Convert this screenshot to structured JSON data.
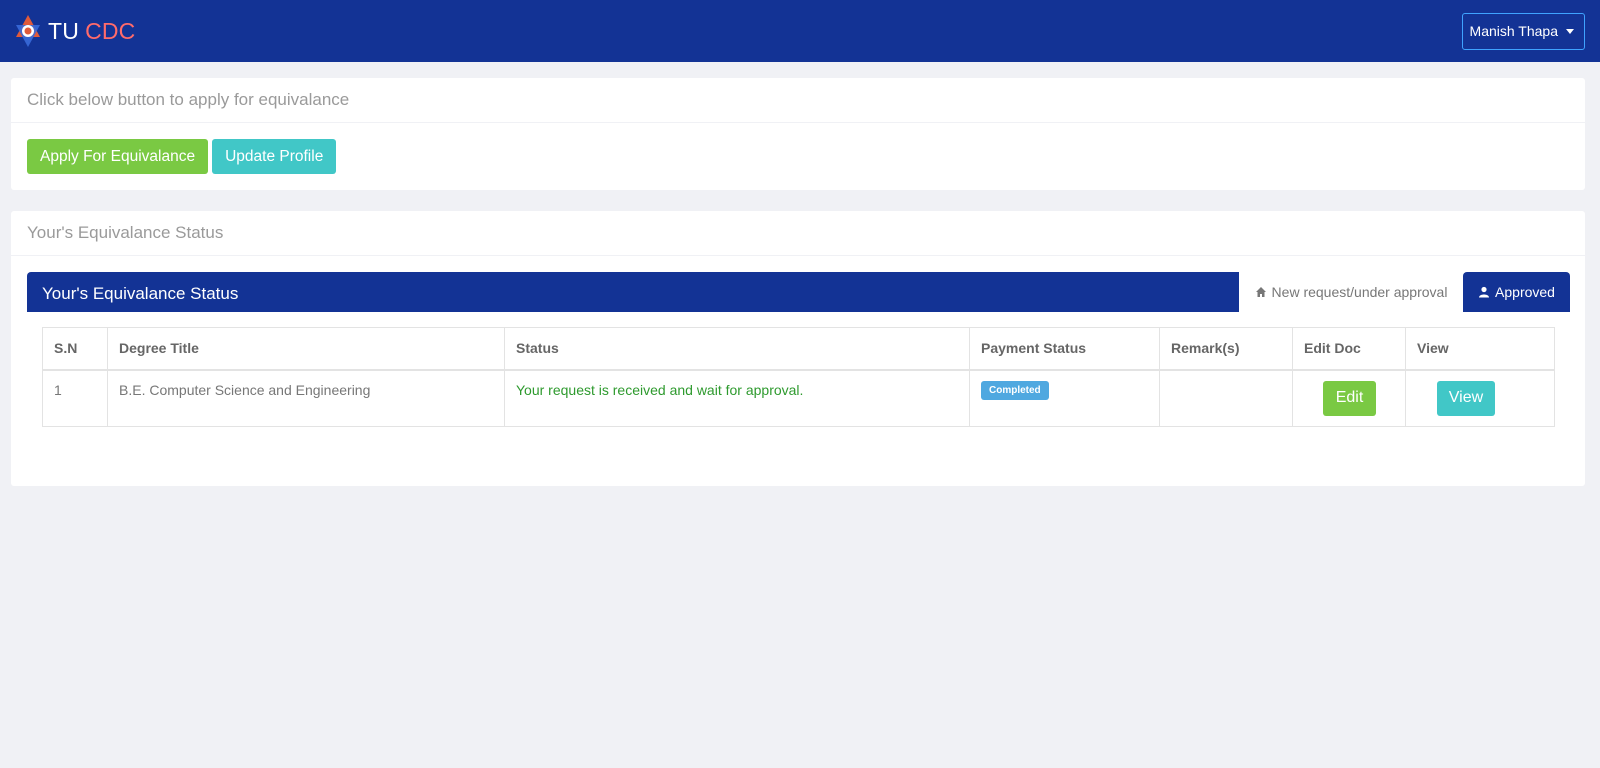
{
  "brand": {
    "tu": "TU",
    "cdc": "CDC",
    "logo_icon": "nepal-star-logo"
  },
  "user": {
    "name": "Manish Thapa"
  },
  "apply_card": {
    "header": "Click below button to apply for equivalance",
    "apply_button": "Apply For Equivalance",
    "update_button": "Update Profile"
  },
  "status_card": {
    "header": "Your's Equivalance Status",
    "tab_title": "Your's Equivalance Status",
    "tabs": [
      {
        "label": "New request/under approval",
        "icon": "home-icon",
        "active": false
      },
      {
        "label": "Approved",
        "icon": "user-icon",
        "active": true
      }
    ],
    "table": {
      "columns": [
        "S.N",
        "Degree Title",
        "Status",
        "Payment Status",
        "Remark(s)",
        "Edit Doc",
        "View"
      ],
      "rows": [
        {
          "sn": "1",
          "degree": "B.E. Computer Science and Engineering",
          "status": "Your request is received and wait for approval.",
          "payment": "Completed",
          "remarks": "",
          "edit": "Edit",
          "view": "View"
        }
      ]
    }
  },
  "colors": {
    "navbar": "#133395",
    "brand_accent": "#ff6b6b",
    "success": "#7ac943",
    "info": "#41c7c7",
    "badge": "#4fa8e0",
    "status_text": "#2e9a2e"
  }
}
